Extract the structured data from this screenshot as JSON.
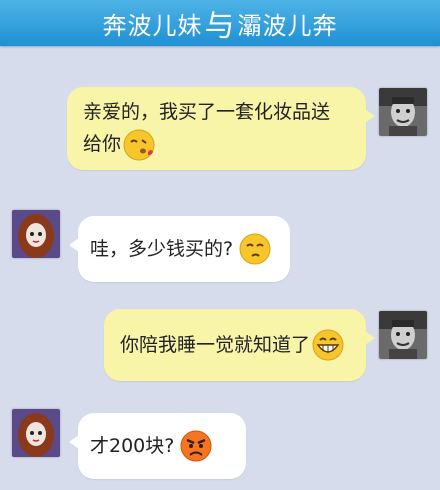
{
  "header": {
    "left_name": "奔波儿妹",
    "separator": "与",
    "right_name": "灞波儿奔"
  },
  "messages": [
    {
      "sender": "right",
      "line1": "亲爱的，我买了一套化妆品送",
      "line2": "给你",
      "emoji": "kiss-face-icon"
    },
    {
      "sender": "left",
      "text": "哇，多少钱买的?",
      "emoji": "smirk-face-icon"
    },
    {
      "sender": "right",
      "text": "你陪我睡一觉就知道了",
      "emoji": "grinning-face-icon"
    },
    {
      "sender": "left",
      "text": "才200块?",
      "emoji": "angry-face-icon"
    }
  ],
  "colors": {
    "header": "#2c9ad9",
    "background": "#d6dcec",
    "outgoing_bubble": "#f8f5a9",
    "incoming_bubble": "#ffffff"
  }
}
